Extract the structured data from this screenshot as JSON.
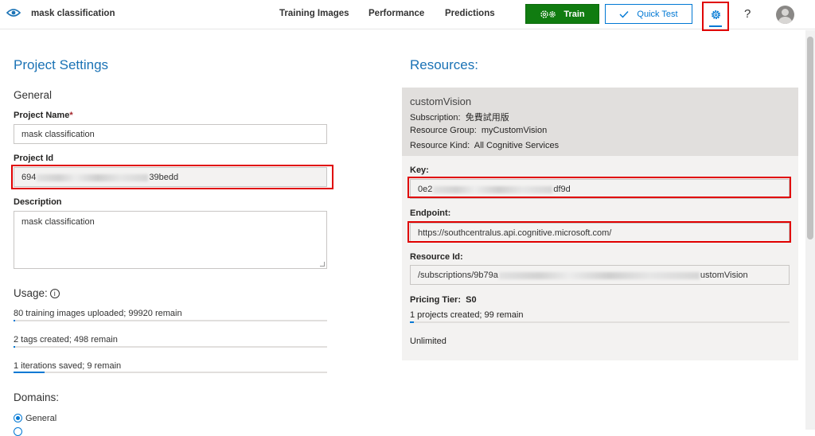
{
  "app": {
    "title": "mask classification"
  },
  "nav": {
    "items": [
      "Training Images",
      "Performance",
      "Predictions"
    ]
  },
  "toolbar": {
    "train_label": "Train",
    "quick_test_label": "Quick Test",
    "help_label": "?"
  },
  "colors": {
    "accent": "#0078d4",
    "train_green": "#107c10",
    "heading_blue": "#1a72b5",
    "highlight_red": "#e00000"
  },
  "settings": {
    "title": "Project Settings",
    "general_heading": "General",
    "project_name_label": "Project Name",
    "project_name_required": "*",
    "project_name_value": "mask classification",
    "project_id_label": "Project Id",
    "project_id_prefix": "694",
    "project_id_suffix": "39bedd",
    "description_label": "Description",
    "description_value": "mask classification",
    "usage_heading": "Usage:",
    "usage": [
      {
        "text": "80 training images uploaded; 99920 remain",
        "fraction": 0.0008
      },
      {
        "text": "2 tags created; 498 remain",
        "fraction": 0.004
      },
      {
        "text": "1 iterations saved; 9 remain",
        "fraction": 0.1
      }
    ],
    "domains_heading": "Domains:",
    "domain_selected": "General"
  },
  "resources": {
    "title": "Resources:",
    "name": "customVision",
    "subscription_label": "Subscription:",
    "subscription_value": "免費試用版",
    "group_label": "Resource Group:",
    "group_value": "myCustomVision",
    "kind_label": "Resource Kind:",
    "kind_value": "All Cognitive Services",
    "key_label": "Key:",
    "key_prefix": "0e2",
    "key_suffix": "df9d",
    "endpoint_label": "Endpoint:",
    "endpoint_value": "https://southcentralus.api.cognitive.microsoft.com/",
    "resource_id_label": "Resource Id:",
    "resource_id_prefix": "/subscriptions/9b79a",
    "resource_id_suffix": "ustomVision",
    "pricing_label": "Pricing Tier:",
    "pricing_value": "S0",
    "projects_text": "1 projects created; 99 remain",
    "projects_fraction": 0.01,
    "unlimited_text": "Unlimited"
  }
}
